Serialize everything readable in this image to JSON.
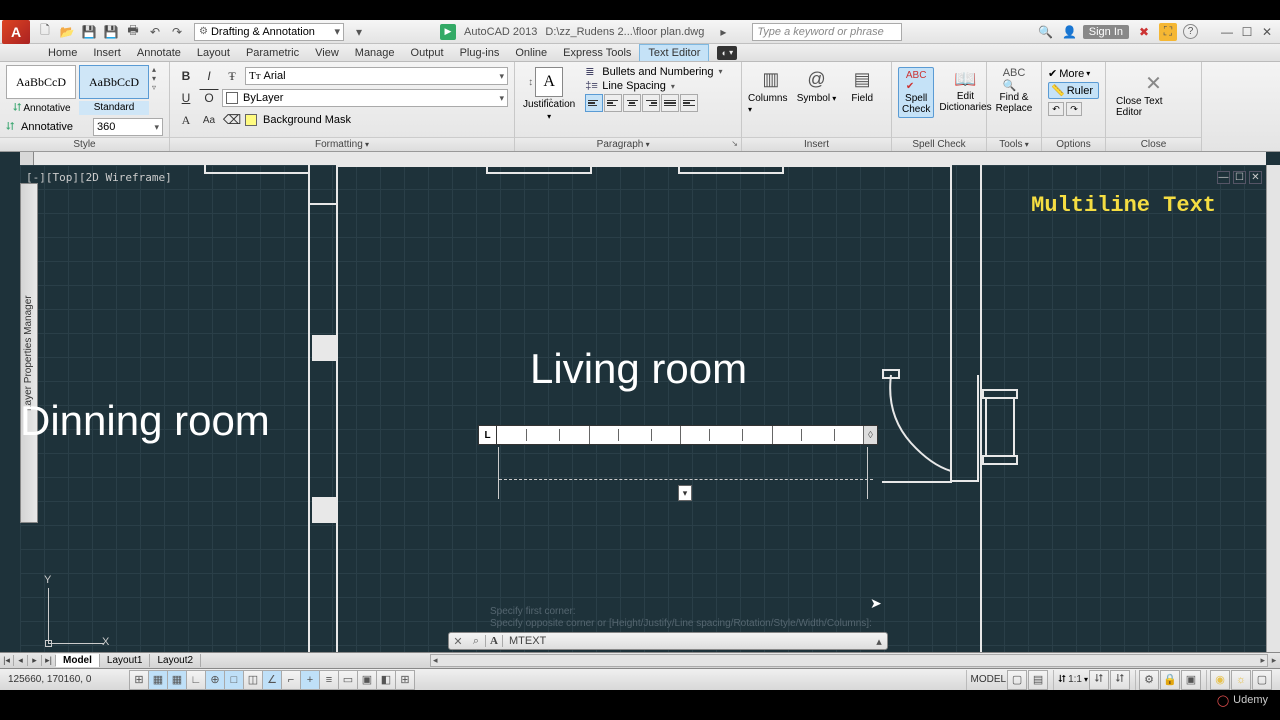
{
  "titlebar": {
    "workspace": "Drafting & Annotation",
    "app": "AutoCAD 2013",
    "doc": "D:\\zz_Rudens 2...\\floor plan.dwg",
    "search_placeholder": "Type a keyword or phrase",
    "signin": "Sign In"
  },
  "menubar": {
    "tabs": [
      "Home",
      "Insert",
      "Annotate",
      "Layout",
      "Parametric",
      "View",
      "Manage",
      "Output",
      "Plug-ins",
      "Online",
      "Express Tools",
      "Text Editor"
    ],
    "active": "Text Editor"
  },
  "ribbon": {
    "style": {
      "title": "Style",
      "swatch_text": "AaBbCcD",
      "annotative": "Annotative",
      "standard": "Standard",
      "font_size": "360"
    },
    "formatting": {
      "title": "Formatting",
      "font": "Arial",
      "color": "ByLayer",
      "bgmask": "Background Mask"
    },
    "paragraph": {
      "title": "Paragraph",
      "justification": "Justification",
      "bullets": "Bullets and Numbering",
      "linespacing": "Line Spacing"
    },
    "insert": {
      "title": "Insert",
      "columns": "Columns",
      "symbol": "Symbol",
      "field": "Field"
    },
    "spell": {
      "title": "Spell Check",
      "spellcheck": "Spell Check",
      "dict": "Edit Dictionaries"
    },
    "tools": {
      "title": "Tools",
      "find": "Find & Replace"
    },
    "options": {
      "title": "Options",
      "more": "More",
      "ruler": "Ruler"
    },
    "close": {
      "title": "Close",
      "label": "Close Text Editor"
    }
  },
  "canvas": {
    "viewport_label": "[-][Top][2D Wireframe]",
    "side_palette": "Layer Properties Manager",
    "living": "Living room",
    "dinning": "Dinning room",
    "multiline": "Multiline Text",
    "ruler_L": "L",
    "handle": "▾",
    "cmd": "MTEXT",
    "cmd_hist1": "Specify first corner:",
    "cmd_hist2": "Specify opposite corner or [Height/Justify/Line spacing/Rotation/Style/Width/Columns]:",
    "ucs_x": "X",
    "ucs_y": "Y"
  },
  "layout": {
    "tabs": [
      "Model",
      "Layout1",
      "Layout2"
    ],
    "active": "Model"
  },
  "status": {
    "coords": "125660, 170160, 0",
    "model": "MODEL",
    "scale": "1:1"
  },
  "footer": {
    "udemy": "Udemy"
  }
}
